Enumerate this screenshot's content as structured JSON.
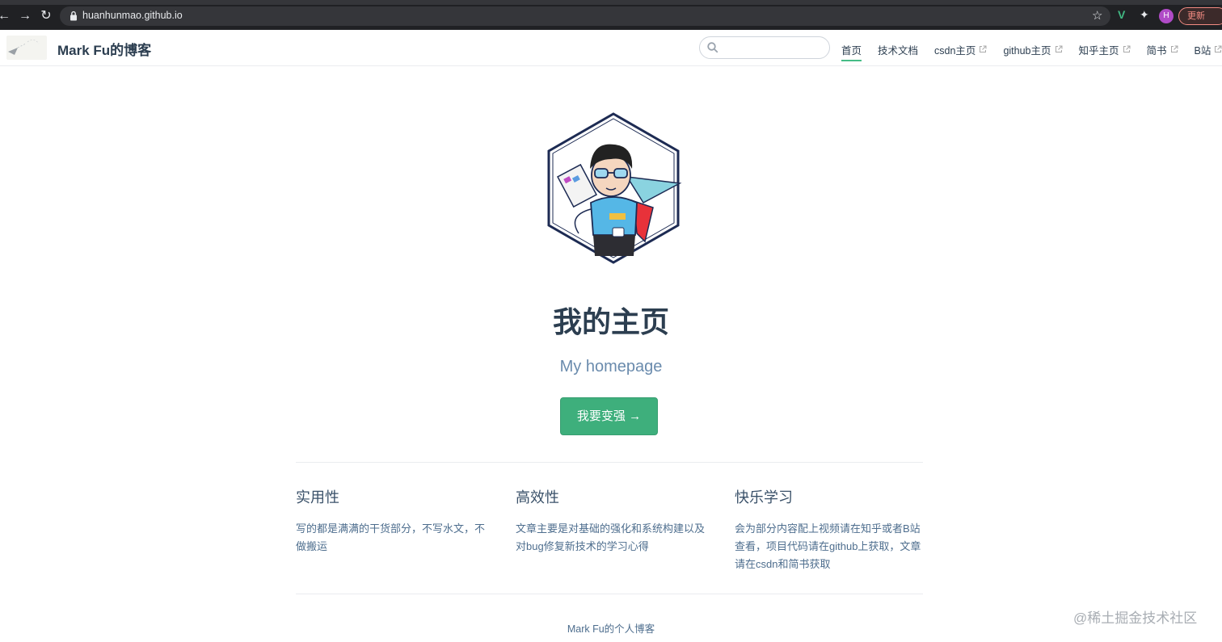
{
  "browser": {
    "url": "huanhunmao.github.io",
    "profile_initial": "H",
    "update_label": "更新"
  },
  "navbar": {
    "site_name": "Mark Fu的博客",
    "search_placeholder": "",
    "links": [
      {
        "label": "首页",
        "active": true,
        "external": false
      },
      {
        "label": "技术文档",
        "active": false,
        "external": false
      },
      {
        "label": "csdn主页",
        "active": false,
        "external": true
      },
      {
        "label": "github主页",
        "active": false,
        "external": true
      },
      {
        "label": "知乎主页",
        "active": false,
        "external": true
      },
      {
        "label": "简书",
        "active": false,
        "external": true
      },
      {
        "label": "B站",
        "active": false,
        "external": true
      }
    ]
  },
  "hero": {
    "title": "我的主页",
    "description": "My homepage",
    "action_label": "我要变强 →"
  },
  "features": [
    {
      "title": "实用性",
      "details": "写的都是满满的干货部分，不写水文，不做搬运"
    },
    {
      "title": "高效性",
      "details": "文章主要是对基础的强化和系统构建以及对bug修复新技术的学习心得"
    },
    {
      "title": "快乐学习",
      "details": "会为部分内容配上视频请在知乎或者B站查看，项目代码请在github上获取，文章请在csdn和简书获取"
    }
  ],
  "footer": {
    "text": "Mark Fu的个人博客"
  },
  "watermark": "@稀土掘金技术社区",
  "colors": {
    "accent": "#3eaf7c",
    "text": "#2c3e50",
    "muted": "#6a8bad"
  }
}
